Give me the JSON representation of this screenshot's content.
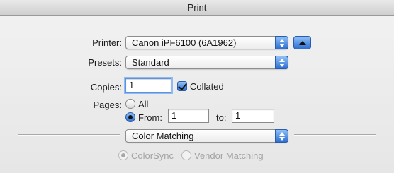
{
  "window": {
    "title": "Print"
  },
  "printer": {
    "label": "Printer:",
    "value": "Canon iPF6100 (6A1962)"
  },
  "presets": {
    "label": "Presets:",
    "value": "Standard"
  },
  "copies": {
    "label": "Copies:",
    "value": "1",
    "collated_label": "Collated",
    "collated_checked": true
  },
  "pages": {
    "label": "Pages:",
    "all_label": "All",
    "from_label": "From:",
    "from_value": "1",
    "to_label": "to:",
    "to_value": "1",
    "selected": "from"
  },
  "panel": {
    "value": "Color Matching"
  },
  "color_matching": {
    "colorsync_label": "ColorSync",
    "vendor_label": "Vendor Matching",
    "selected": "colorsync",
    "enabled": false
  },
  "colors": {
    "accent": "#2d6fd1",
    "accent_light": "#8fc0f7"
  }
}
